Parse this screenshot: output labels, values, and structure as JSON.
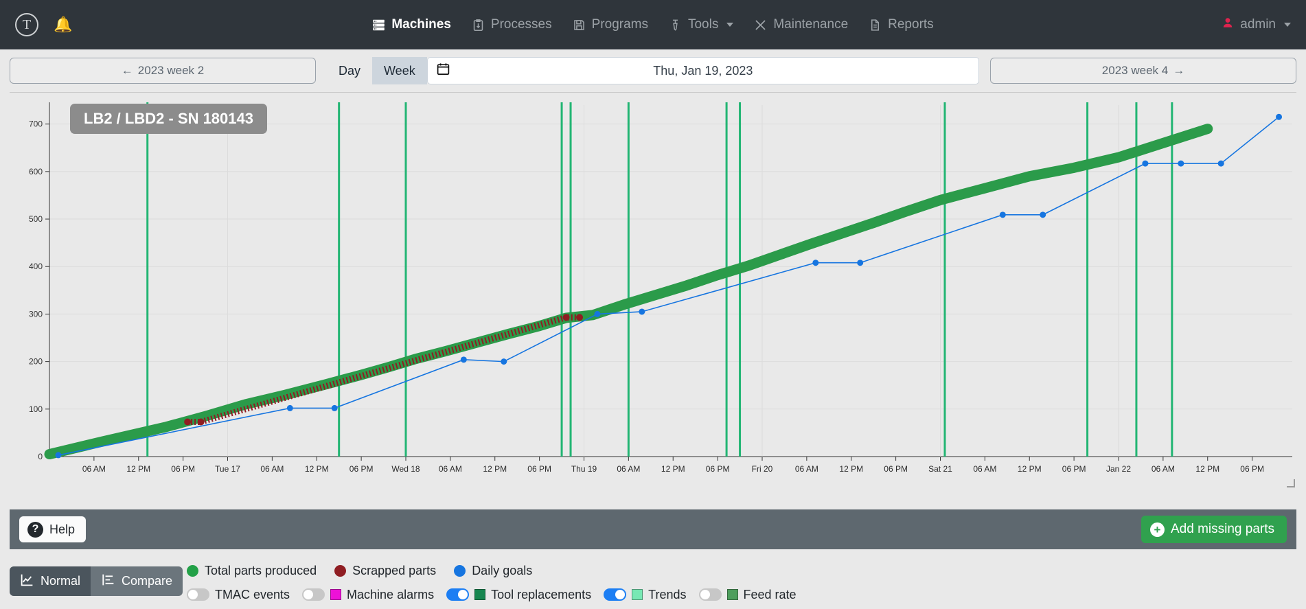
{
  "topnav": {
    "logo_letter": "T",
    "bell_icon": "bell-icon",
    "items": [
      {
        "label": "Machines",
        "icon": "server-rack-icon",
        "active": true,
        "caret": false
      },
      {
        "label": "Processes",
        "icon": "clipboard-icon",
        "active": false,
        "caret": false
      },
      {
        "label": "Programs",
        "icon": "save-disk-icon",
        "active": false,
        "caret": false
      },
      {
        "label": "Tools",
        "icon": "drill-bit-icon",
        "active": false,
        "caret": true
      },
      {
        "label": "Maintenance",
        "icon": "tools-cross-icon",
        "active": false,
        "caret": false
      },
      {
        "label": "Reports",
        "icon": "document-icon",
        "active": false,
        "caret": false
      }
    ],
    "user": {
      "label": "admin",
      "icon": "user-icon",
      "color": "#e0234e"
    }
  },
  "toolbar": {
    "prev_week": "2023 week 2",
    "prev_arrow": "←",
    "next_week": "2023 week 4",
    "next_arrow": "→",
    "range_day": "Day",
    "range_week": "Week",
    "range_selected": "Week",
    "calendar_icon": "calendar-icon",
    "date_value": "Thu, Jan 19, 2023"
  },
  "chart": {
    "machine_badge": "LB2 / LBD2 - SN 180143"
  },
  "chart_data": {
    "type": "line",
    "title": "LB2 / LBD2 - SN 180143",
    "xlabel": "",
    "ylabel": "",
    "ylim": [
      0,
      740
    ],
    "yticks": [
      0,
      100,
      200,
      300,
      400,
      500,
      600,
      700
    ],
    "grid": true,
    "legend_position": "bottom",
    "xticks": [
      "06 AM",
      "12 PM",
      "06 PM",
      "Tue 17",
      "06 AM",
      "12 PM",
      "06 PM",
      "Wed 18",
      "06 AM",
      "12 PM",
      "06 PM",
      "Thu 19",
      "06 AM",
      "12 PM",
      "06 PM",
      "Fri 20",
      "06 AM",
      "12 PM",
      "06 PM",
      "Sat 21",
      "06 AM",
      "12 PM",
      "06 PM",
      "Jan 22",
      "06 AM",
      "12 PM",
      "06 PM"
    ],
    "series": [
      {
        "name": "Total parts produced",
        "color": "#2b9b4a",
        "style": "thick-line",
        "x": [
          0,
          1.2,
          2.6,
          3.5,
          4.4,
          5.3,
          6.2,
          7.0,
          7.6,
          8.2,
          8.9,
          9.6,
          10.3,
          11.0,
          11.6,
          12.2,
          12.9,
          13.6,
          14.3,
          15.0,
          15.7,
          16.4,
          17.1,
          17.8,
          18.5,
          19.2,
          20.0,
          21.0,
          22.0,
          23.0,
          24.0,
          25.0,
          26.0
        ],
        "values": [
          5,
          32,
          62,
          85,
          110,
          130,
          152,
          172,
          188,
          205,
          222,
          240,
          258,
          275,
          292,
          298,
          320,
          340,
          360,
          382,
          402,
          425,
          448,
          470,
          492,
          515,
          540,
          565,
          590,
          608,
          630,
          660,
          690
        ]
      },
      {
        "name": "Daily goals",
        "color": "#1675e0",
        "style": "thin-line-markers",
        "x": [
          0.2,
          5.4,
          6.4,
          9.3,
          10.2,
          12.3,
          13.3,
          17.2,
          18.2,
          21.4,
          22.3,
          24.6,
          25.4,
          26.3,
          27.6
        ],
        "values": [
          3,
          102,
          102,
          204,
          200,
          300,
          305,
          408,
          408,
          509,
          509,
          617,
          617,
          617,
          715
        ]
      },
      {
        "name": "Scrapped parts",
        "color": "#8f1d22",
        "style": "markers",
        "x": [
          3.1,
          3.4,
          11.6,
          11.9
        ],
        "values": [
          73,
          73,
          293,
          293
        ]
      }
    ],
    "vertical_markers": {
      "name": "Tool replacements",
      "color": "#22b573",
      "x": [
        2.2,
        6.5,
        8.0,
        11.5,
        11.7,
        13.0,
        15.2,
        15.5,
        20.1,
        23.3,
        24.4,
        25.2
      ]
    }
  },
  "bottombar": {
    "help_label": "Help",
    "help_icon": "question-mark-icon",
    "add_label": "Add missing parts",
    "add_icon": "plus-circle-icon",
    "add_color": "#30a14e"
  },
  "modes": {
    "normal_label": "Normal",
    "normal_icon": "line-chart-icon",
    "compare_label": "Compare",
    "compare_icon": "compare-bars-icon",
    "selected": "Normal"
  },
  "legend": {
    "series": [
      {
        "label": "Total parts produced",
        "color": "#23a148"
      },
      {
        "label": "Scrapped parts",
        "color": "#8f1d22"
      },
      {
        "label": "Daily goals",
        "color": "#1675e0"
      }
    ],
    "toggles": [
      {
        "label": "TMAC events",
        "on": false,
        "swatch": null
      },
      {
        "label": "Machine alarms",
        "on": false,
        "swatch": "#ed11d7"
      },
      {
        "label": "Tool replacements",
        "on": true,
        "swatch": "#16864f"
      },
      {
        "label": "Trends",
        "on": true,
        "swatch": "#77e8b4"
      },
      {
        "label": "Feed rate",
        "on": false,
        "swatch": "#4d9e5c"
      }
    ]
  }
}
